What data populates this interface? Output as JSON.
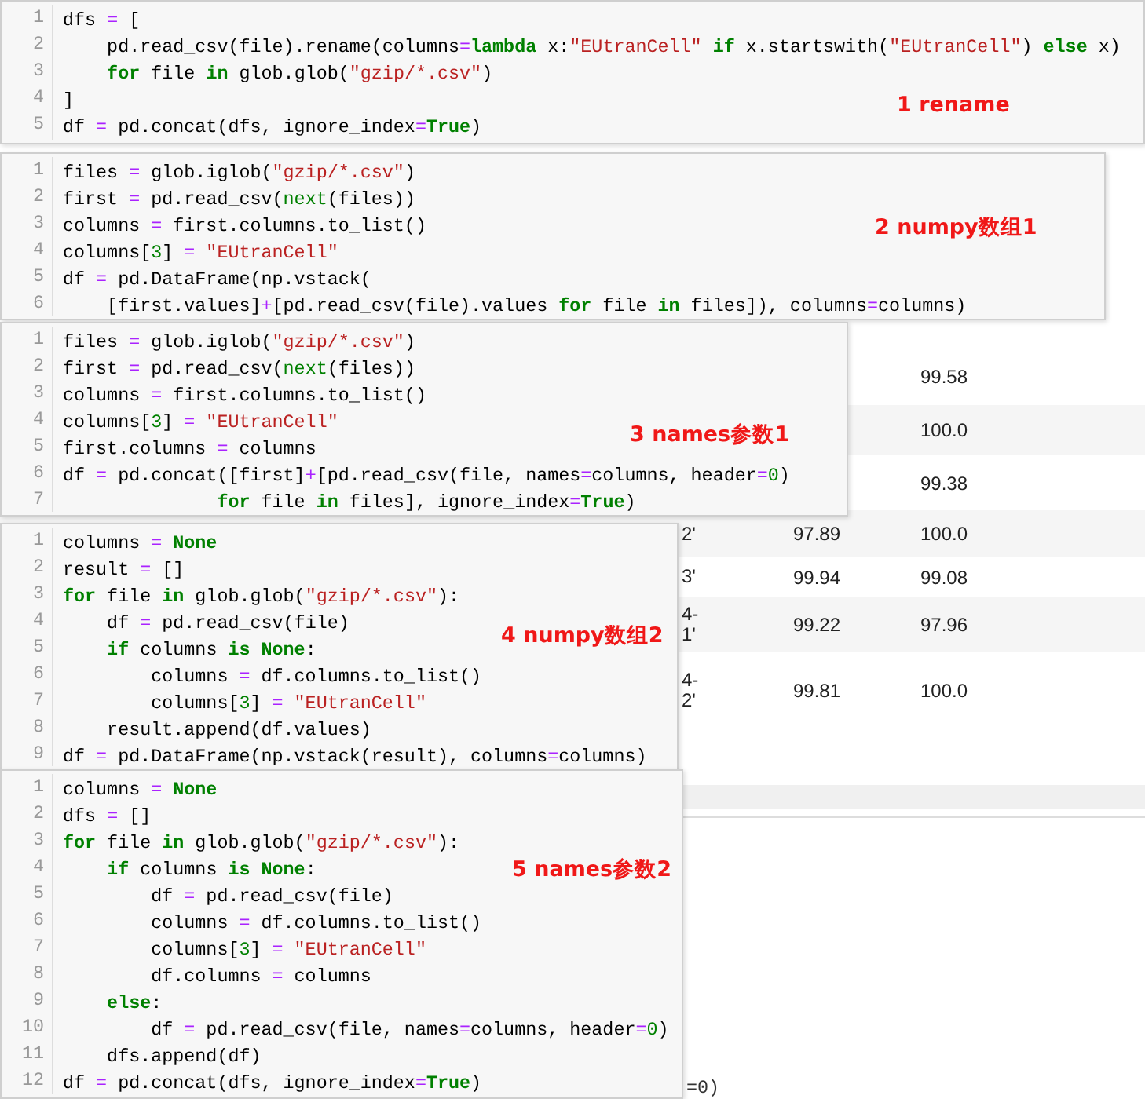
{
  "background_table": {
    "rows": [
      {
        "column_3": "99.58"
      },
      {
        "column_3": "100.0"
      },
      {
        "column_3": "99.38"
      },
      {
        "column_1": "2'",
        "column_2": "97.89",
        "column_3": "100.0"
      },
      {
        "column_1": "3'",
        "column_2": "99.94",
        "column_3": "99.08"
      },
      {
        "column_1": "4-\n1'",
        "column_2": "99.22",
        "column_3": "97.96"
      },
      {
        "column_1": "4-\n2'",
        "column_2": "99.81",
        "column_3": "100.0"
      }
    ],
    "bottom_fragment": "=0)"
  },
  "code_cells": [
    {
      "label": "1 rename",
      "lines": [
        {
          "number": "1",
          "segments": [
            {
              "kind": "plain",
              "text": "dfs "
            },
            {
              "kind": "op",
              "text": "="
            },
            {
              "kind": "plain",
              "text": " ["
            }
          ]
        },
        {
          "number": "2",
          "segments": [
            {
              "kind": "plain",
              "text": "    pd.read_csv(file).rename(columns"
            },
            {
              "kind": "op",
              "text": "="
            },
            {
              "kind": "kw",
              "text": "lambda"
            },
            {
              "kind": "plain",
              "text": " x:"
            },
            {
              "kind": "str",
              "text": "\"EUtranCell\""
            },
            {
              "kind": "kw",
              "text": " if"
            },
            {
              "kind": "plain",
              "text": " x.startswith("
            },
            {
              "kind": "str",
              "text": "\"EUtranCell\""
            },
            {
              "kind": "plain",
              "text": ") "
            },
            {
              "kind": "kw",
              "text": "else"
            },
            {
              "kind": "plain",
              "text": " x)"
            }
          ]
        },
        {
          "number": "3",
          "segments": [
            {
              "kind": "kw",
              "text": "    for"
            },
            {
              "kind": "plain",
              "text": " file "
            },
            {
              "kind": "kw",
              "text": "in"
            },
            {
              "kind": "plain",
              "text": " glob.glob("
            },
            {
              "kind": "str",
              "text": "\"gzip/*.csv\""
            },
            {
              "kind": "plain",
              "text": ")"
            }
          ]
        },
        {
          "number": "4",
          "segments": [
            {
              "kind": "plain",
              "text": "]"
            }
          ]
        },
        {
          "number": "5",
          "segments": [
            {
              "kind": "plain",
              "text": "df "
            },
            {
              "kind": "op",
              "text": "="
            },
            {
              "kind": "plain",
              "text": " pd.concat(dfs, ignore_index"
            },
            {
              "kind": "op",
              "text": "="
            },
            {
              "kind": "kw",
              "text": "True"
            },
            {
              "kind": "plain",
              "text": ")"
            }
          ]
        }
      ]
    },
    {
      "label": "2 numpy数组1",
      "lines": [
        {
          "number": "1",
          "segments": [
            {
              "kind": "plain",
              "text": "files "
            },
            {
              "kind": "op",
              "text": "="
            },
            {
              "kind": "plain",
              "text": " glob.iglob("
            },
            {
              "kind": "str",
              "text": "\"gzip/*.csv\""
            },
            {
              "kind": "plain",
              "text": ")"
            }
          ]
        },
        {
          "number": "2",
          "segments": [
            {
              "kind": "plain",
              "text": "first "
            },
            {
              "kind": "op",
              "text": "="
            },
            {
              "kind": "plain",
              "text": " pd.read_csv("
            },
            {
              "kind": "builtin",
              "text": "next"
            },
            {
              "kind": "plain",
              "text": "(files))"
            }
          ]
        },
        {
          "number": "3",
          "segments": [
            {
              "kind": "plain",
              "text": "columns "
            },
            {
              "kind": "op",
              "text": "="
            },
            {
              "kind": "plain",
              "text": " first.columns.to_list()"
            }
          ]
        },
        {
          "number": "4",
          "segments": [
            {
              "kind": "plain",
              "text": "columns["
            },
            {
              "kind": "num",
              "text": "3"
            },
            {
              "kind": "plain",
              "text": "] "
            },
            {
              "kind": "op",
              "text": "="
            },
            {
              "kind": "str",
              "text": " \"EUtranCell\""
            }
          ]
        },
        {
          "number": "5",
          "segments": [
            {
              "kind": "plain",
              "text": "df "
            },
            {
              "kind": "op",
              "text": "="
            },
            {
              "kind": "plain",
              "text": " pd.DataFrame(np.vstack("
            }
          ]
        },
        {
          "number": "6",
          "segments": [
            {
              "kind": "plain",
              "text": "    [first.values]"
            },
            {
              "kind": "op",
              "text": "+"
            },
            {
              "kind": "plain",
              "text": "[pd.read_csv(file).values "
            },
            {
              "kind": "kw",
              "text": "for"
            },
            {
              "kind": "plain",
              "text": " file "
            },
            {
              "kind": "kw",
              "text": "in"
            },
            {
              "kind": "plain",
              "text": " files]), columns"
            },
            {
              "kind": "op",
              "text": "="
            },
            {
              "kind": "plain",
              "text": "columns)"
            }
          ]
        }
      ]
    },
    {
      "label": "3 names参数1",
      "lines": [
        {
          "number": "1",
          "segments": [
            {
              "kind": "plain",
              "text": "files "
            },
            {
              "kind": "op",
              "text": "="
            },
            {
              "kind": "plain",
              "text": " glob.iglob("
            },
            {
              "kind": "str",
              "text": "\"gzip/*.csv\""
            },
            {
              "kind": "plain",
              "text": ")"
            }
          ]
        },
        {
          "number": "2",
          "segments": [
            {
              "kind": "plain",
              "text": "first "
            },
            {
              "kind": "op",
              "text": "="
            },
            {
              "kind": "plain",
              "text": " pd.read_csv("
            },
            {
              "kind": "builtin",
              "text": "next"
            },
            {
              "kind": "plain",
              "text": "(files))"
            }
          ]
        },
        {
          "number": "3",
          "segments": [
            {
              "kind": "plain",
              "text": "columns "
            },
            {
              "kind": "op",
              "text": "="
            },
            {
              "kind": "plain",
              "text": " first.columns.to_list()"
            }
          ]
        },
        {
          "number": "4",
          "segments": [
            {
              "kind": "plain",
              "text": "columns["
            },
            {
              "kind": "num",
              "text": "3"
            },
            {
              "kind": "plain",
              "text": "] "
            },
            {
              "kind": "op",
              "text": "="
            },
            {
              "kind": "str",
              "text": " \"EUtranCell\""
            }
          ]
        },
        {
          "number": "5",
          "segments": [
            {
              "kind": "plain",
              "text": "first.columns "
            },
            {
              "kind": "op",
              "text": "="
            },
            {
              "kind": "plain",
              "text": " columns"
            }
          ]
        },
        {
          "number": "6",
          "segments": [
            {
              "kind": "plain",
              "text": "df "
            },
            {
              "kind": "op",
              "text": "="
            },
            {
              "kind": "plain",
              "text": " pd.concat([first]"
            },
            {
              "kind": "op",
              "text": "+"
            },
            {
              "kind": "plain",
              "text": "[pd.read_csv(file, names"
            },
            {
              "kind": "op",
              "text": "="
            },
            {
              "kind": "plain",
              "text": "columns, header"
            },
            {
              "kind": "op",
              "text": "="
            },
            {
              "kind": "num",
              "text": "0"
            },
            {
              "kind": "plain",
              "text": ")"
            }
          ]
        },
        {
          "number": "7",
          "segments": [
            {
              "kind": "kw",
              "text": "              for"
            },
            {
              "kind": "plain",
              "text": " file "
            },
            {
              "kind": "kw",
              "text": "in"
            },
            {
              "kind": "plain",
              "text": " files], ignore_index"
            },
            {
              "kind": "op",
              "text": "="
            },
            {
              "kind": "kw",
              "text": "True"
            },
            {
              "kind": "plain",
              "text": ")"
            }
          ]
        }
      ]
    },
    {
      "label": "4 numpy数组2",
      "lines": [
        {
          "number": "1",
          "segments": [
            {
              "kind": "plain",
              "text": "columns "
            },
            {
              "kind": "op",
              "text": "="
            },
            {
              "kind": "kw",
              "text": " None"
            }
          ]
        },
        {
          "number": "2",
          "segments": [
            {
              "kind": "plain",
              "text": "result "
            },
            {
              "kind": "op",
              "text": "="
            },
            {
              "kind": "plain",
              "text": " []"
            }
          ]
        },
        {
          "number": "3",
          "segments": [
            {
              "kind": "kw",
              "text": "for"
            },
            {
              "kind": "plain",
              "text": " file "
            },
            {
              "kind": "kw",
              "text": "in"
            },
            {
              "kind": "plain",
              "text": " glob.glob("
            },
            {
              "kind": "str",
              "text": "\"gzip/*.csv\""
            },
            {
              "kind": "plain",
              "text": "):"
            }
          ]
        },
        {
          "number": "4",
          "segments": [
            {
              "kind": "plain",
              "text": "    df "
            },
            {
              "kind": "op",
              "text": "="
            },
            {
              "kind": "plain",
              "text": " pd.read_csv(file)"
            }
          ]
        },
        {
          "number": "5",
          "segments": [
            {
              "kind": "kw",
              "text": "    if"
            },
            {
              "kind": "plain",
              "text": " columns "
            },
            {
              "kind": "kw",
              "text": "is"
            },
            {
              "kind": "kw",
              "text": " None"
            },
            {
              "kind": "plain",
              "text": ":"
            }
          ]
        },
        {
          "number": "6",
          "segments": [
            {
              "kind": "plain",
              "text": "        columns "
            },
            {
              "kind": "op",
              "text": "="
            },
            {
              "kind": "plain",
              "text": " df.columns.to_list()"
            }
          ]
        },
        {
          "number": "7",
          "segments": [
            {
              "kind": "plain",
              "text": "        columns["
            },
            {
              "kind": "num",
              "text": "3"
            },
            {
              "kind": "plain",
              "text": "] "
            },
            {
              "kind": "op",
              "text": "="
            },
            {
              "kind": "str",
              "text": " \"EUtranCell\""
            }
          ]
        },
        {
          "number": "8",
          "segments": [
            {
              "kind": "plain",
              "text": "    result.append(df.values)"
            }
          ]
        },
        {
          "number": "9",
          "segments": [
            {
              "kind": "plain",
              "text": "df "
            },
            {
              "kind": "op",
              "text": "="
            },
            {
              "kind": "plain",
              "text": " pd.DataFrame(np.vstack(result), columns"
            },
            {
              "kind": "op",
              "text": "="
            },
            {
              "kind": "plain",
              "text": "columns)"
            }
          ]
        }
      ]
    },
    {
      "label": "5 names参数2",
      "lines": [
        {
          "number": "1",
          "segments": [
            {
              "kind": "plain",
              "text": "columns "
            },
            {
              "kind": "op",
              "text": "="
            },
            {
              "kind": "kw",
              "text": " None"
            }
          ]
        },
        {
          "number": "2",
          "segments": [
            {
              "kind": "plain",
              "text": "dfs "
            },
            {
              "kind": "op",
              "text": "="
            },
            {
              "kind": "plain",
              "text": " []"
            }
          ]
        },
        {
          "number": "3",
          "segments": [
            {
              "kind": "kw",
              "text": "for"
            },
            {
              "kind": "plain",
              "text": " file "
            },
            {
              "kind": "kw",
              "text": "in"
            },
            {
              "kind": "plain",
              "text": " glob.glob("
            },
            {
              "kind": "str",
              "text": "\"gzip/*.csv\""
            },
            {
              "kind": "plain",
              "text": "):"
            }
          ]
        },
        {
          "number": "4",
          "segments": [
            {
              "kind": "kw",
              "text": "    if"
            },
            {
              "kind": "plain",
              "text": " columns "
            },
            {
              "kind": "kw",
              "text": "is"
            },
            {
              "kind": "kw",
              "text": " None"
            },
            {
              "kind": "plain",
              "text": ":"
            }
          ]
        },
        {
          "number": "5",
          "segments": [
            {
              "kind": "plain",
              "text": "        df "
            },
            {
              "kind": "op",
              "text": "="
            },
            {
              "kind": "plain",
              "text": " pd.read_csv(file)"
            }
          ]
        },
        {
          "number": "6",
          "segments": [
            {
              "kind": "plain",
              "text": "        columns "
            },
            {
              "kind": "op",
              "text": "="
            },
            {
              "kind": "plain",
              "text": " df.columns.to_list()"
            }
          ]
        },
        {
          "number": "7",
          "segments": [
            {
              "kind": "plain",
              "text": "        columns["
            },
            {
              "kind": "num",
              "text": "3"
            },
            {
              "kind": "plain",
              "text": "] "
            },
            {
              "kind": "op",
              "text": "="
            },
            {
              "kind": "str",
              "text": " \"EUtranCell\""
            }
          ]
        },
        {
          "number": "8",
          "segments": [
            {
              "kind": "plain",
              "text": "        df.columns "
            },
            {
              "kind": "op",
              "text": "="
            },
            {
              "kind": "plain",
              "text": " columns"
            }
          ]
        },
        {
          "number": "9",
          "segments": [
            {
              "kind": "kw",
              "text": "    else"
            },
            {
              "kind": "plain",
              "text": ":"
            }
          ]
        },
        {
          "number": "10",
          "segments": [
            {
              "kind": "plain",
              "text": "        df "
            },
            {
              "kind": "op",
              "text": "="
            },
            {
              "kind": "plain",
              "text": " pd.read_csv(file, names"
            },
            {
              "kind": "op",
              "text": "="
            },
            {
              "kind": "plain",
              "text": "columns, header"
            },
            {
              "kind": "op",
              "text": "="
            },
            {
              "kind": "num",
              "text": "0"
            },
            {
              "kind": "plain",
              "text": ")"
            }
          ]
        },
        {
          "number": "11",
          "segments": [
            {
              "kind": "plain",
              "text": "    dfs.append(df)"
            }
          ]
        },
        {
          "number": "12",
          "segments": [
            {
              "kind": "plain",
              "text": "df "
            },
            {
              "kind": "op",
              "text": "="
            },
            {
              "kind": "plain",
              "text": " pd.concat(dfs, ignore_index"
            },
            {
              "kind": "op",
              "text": "="
            },
            {
              "kind": "kw",
              "text": "True"
            },
            {
              "kind": "plain",
              "text": ")"
            }
          ]
        }
      ]
    }
  ]
}
